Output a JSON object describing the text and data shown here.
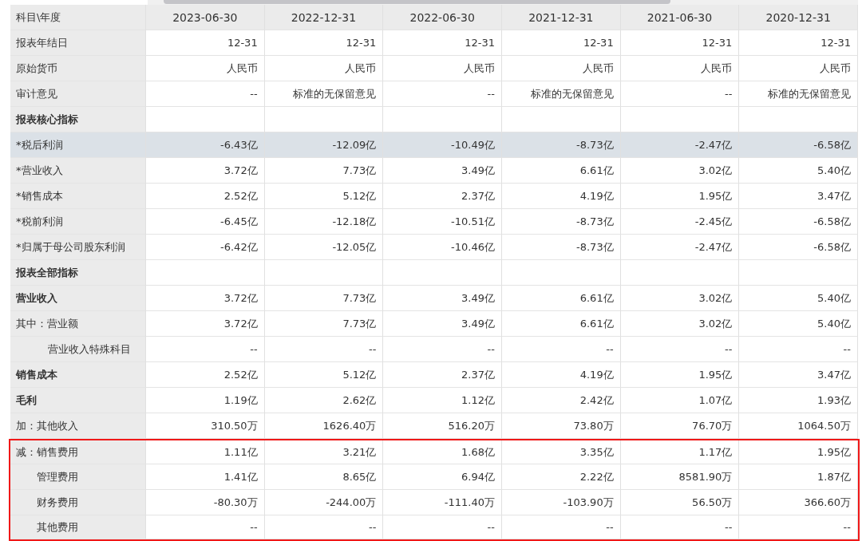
{
  "table": {
    "corner": "科目\\年度",
    "columns": [
      "2023-06-30",
      "2022-12-31",
      "2022-06-30",
      "2021-12-31",
      "2021-06-30",
      "2020-12-31"
    ],
    "rows": [
      {
        "label": "报表年结日",
        "kind": "plain",
        "highlighted": false,
        "boxed": false,
        "values": [
          "12-31",
          "12-31",
          "12-31",
          "12-31",
          "12-31",
          "12-31"
        ]
      },
      {
        "label": "原始货币",
        "kind": "plain",
        "highlighted": false,
        "boxed": false,
        "values": [
          "人民币",
          "人民币",
          "人民币",
          "人民币",
          "人民币",
          "人民币"
        ]
      },
      {
        "label": "审计意见",
        "kind": "plain",
        "highlighted": false,
        "boxed": false,
        "values": [
          "--",
          "标准的无保留意见",
          "--",
          "标准的无保留意见",
          "--",
          "标准的无保留意见"
        ]
      },
      {
        "label": "报表核心指标",
        "kind": "section",
        "highlighted": false,
        "boxed": false,
        "values": []
      },
      {
        "label": "*税后利润",
        "kind": "plain",
        "highlighted": true,
        "boxed": false,
        "values": [
          "-6.43亿",
          "-12.09亿",
          "-10.49亿",
          "-8.73亿",
          "-2.47亿",
          "-6.58亿"
        ]
      },
      {
        "label": "*营业收入",
        "kind": "plain",
        "highlighted": false,
        "boxed": false,
        "values": [
          "3.72亿",
          "7.73亿",
          "3.49亿",
          "6.61亿",
          "3.02亿",
          "5.40亿"
        ]
      },
      {
        "label": "*销售成本",
        "kind": "plain",
        "highlighted": false,
        "boxed": false,
        "values": [
          "2.52亿",
          "5.12亿",
          "2.37亿",
          "4.19亿",
          "1.95亿",
          "3.47亿"
        ]
      },
      {
        "label": "*税前利润",
        "kind": "plain",
        "highlighted": false,
        "boxed": false,
        "values": [
          "-6.45亿",
          "-12.18亿",
          "-10.51亿",
          "-8.73亿",
          "-2.45亿",
          "-6.58亿"
        ]
      },
      {
        "label": "*归属于母公司股东利润",
        "kind": "plain",
        "highlighted": false,
        "boxed": false,
        "values": [
          "-6.42亿",
          "-12.05亿",
          "-10.46亿",
          "-8.73亿",
          "-2.47亿",
          "-6.58亿"
        ]
      },
      {
        "label": "报表全部指标",
        "kind": "section",
        "highlighted": false,
        "boxed": false,
        "values": []
      },
      {
        "label": "营业收入",
        "kind": "bold",
        "highlighted": false,
        "boxed": false,
        "values": [
          "3.72亿",
          "7.73亿",
          "3.49亿",
          "6.61亿",
          "3.02亿",
          "5.40亿"
        ]
      },
      {
        "label": "其中：营业额",
        "kind": "plain",
        "highlighted": false,
        "boxed": false,
        "values": [
          "3.72亿",
          "7.73亿",
          "3.49亿",
          "6.61亿",
          "3.02亿",
          "5.40亿"
        ]
      },
      {
        "label": "营业收入特殊科目",
        "kind": "indent2",
        "highlighted": false,
        "boxed": false,
        "values": [
          "--",
          "--",
          "--",
          "--",
          "--",
          "--"
        ]
      },
      {
        "label": "销售成本",
        "kind": "bold",
        "highlighted": false,
        "boxed": false,
        "values": [
          "2.52亿",
          "5.12亿",
          "2.37亿",
          "4.19亿",
          "1.95亿",
          "3.47亿"
        ]
      },
      {
        "label": "毛利",
        "kind": "bold",
        "highlighted": false,
        "boxed": false,
        "values": [
          "1.19亿",
          "2.62亿",
          "1.12亿",
          "2.42亿",
          "1.07亿",
          "1.93亿"
        ]
      },
      {
        "label": "加：其他收入",
        "kind": "plain",
        "highlighted": false,
        "boxed": false,
        "values": [
          "310.50万",
          "1626.40万",
          "516.20万",
          "73.80万",
          "76.70万",
          "1064.50万"
        ]
      },
      {
        "label": "减：销售费用",
        "kind": "plain",
        "highlighted": false,
        "boxed": true,
        "values": [
          "1.11亿",
          "3.21亿",
          "1.68亿",
          "3.35亿",
          "1.17亿",
          "1.95亿"
        ]
      },
      {
        "label": "管理费用",
        "kind": "indent1",
        "highlighted": false,
        "boxed": true,
        "values": [
          "1.41亿",
          "8.65亿",
          "6.94亿",
          "2.22亿",
          "8581.90万",
          "1.87亿"
        ]
      },
      {
        "label": "财务费用",
        "kind": "indent1",
        "highlighted": false,
        "boxed": true,
        "values": [
          "-80.30万",
          "-244.00万",
          "-111.40万",
          "-103.90万",
          "56.50万",
          "366.60万"
        ]
      },
      {
        "label": "其他费用",
        "kind": "indent1",
        "highlighted": false,
        "boxed": true,
        "values": [
          "--",
          "--",
          "--",
          "--",
          "--",
          "--"
        ]
      }
    ]
  }
}
